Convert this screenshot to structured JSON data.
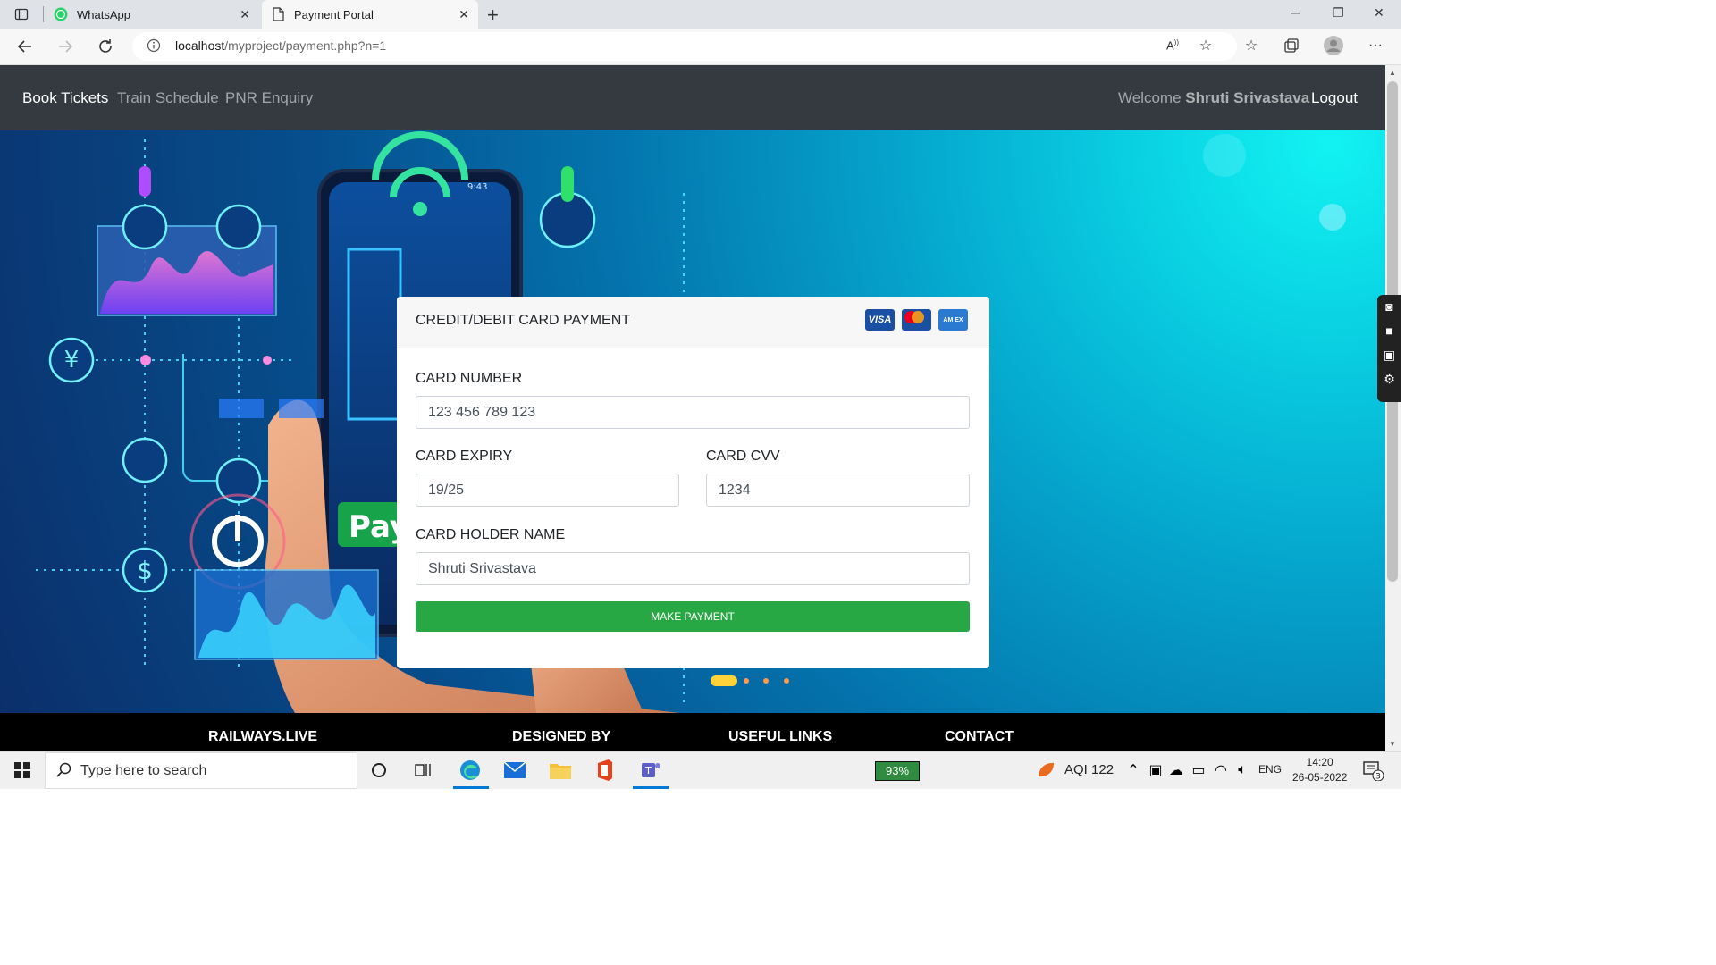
{
  "browser": {
    "tabs": [
      {
        "title": "WhatsApp",
        "active": false
      },
      {
        "title": "Payment Portal",
        "active": true
      }
    ],
    "url_host": "localhost",
    "url_path": "/myproject/payment.php?n=1"
  },
  "navbar": {
    "links": [
      "Book Tickets",
      "Train Schedule",
      "PNR Enquiry"
    ],
    "welcome_prefix": "Welcome",
    "user_name": "Shruti Srivastava",
    "logout": "Logout"
  },
  "payment": {
    "title": "CREDIT/DEBIT CARD PAYMENT",
    "card_brands": [
      "VISA",
      "MASTERCARD",
      "AMEX"
    ],
    "card_number_label": "CARD NUMBER",
    "card_number_value": "123 456 789 123",
    "expiry_label": "CARD EXPIRY",
    "expiry_value": "19/25",
    "cvv_label": "CARD CVV",
    "cvv_value": "1234",
    "holder_label": "CARD HOLDER NAME",
    "holder_value": "Shruti Srivastava",
    "submit": "MAKE PAYMENT"
  },
  "hero": {
    "phone_time": "9:43",
    "pay_text": "Pay"
  },
  "footer": {
    "headings": [
      "RAILWAYS.LIVE",
      "DESIGNED BY",
      "USEFUL LINKS",
      "CONTACT"
    ]
  },
  "taskbar": {
    "search_placeholder": "Type here to search",
    "battery": "93%",
    "aqi": "AQI 122",
    "lang": "ENG",
    "time": "14:20",
    "date": "26-05-2022",
    "notifications": "3"
  },
  "colors": {
    "navbar": "#343a40",
    "pay_button": "#28a745",
    "footer": "#000000"
  }
}
